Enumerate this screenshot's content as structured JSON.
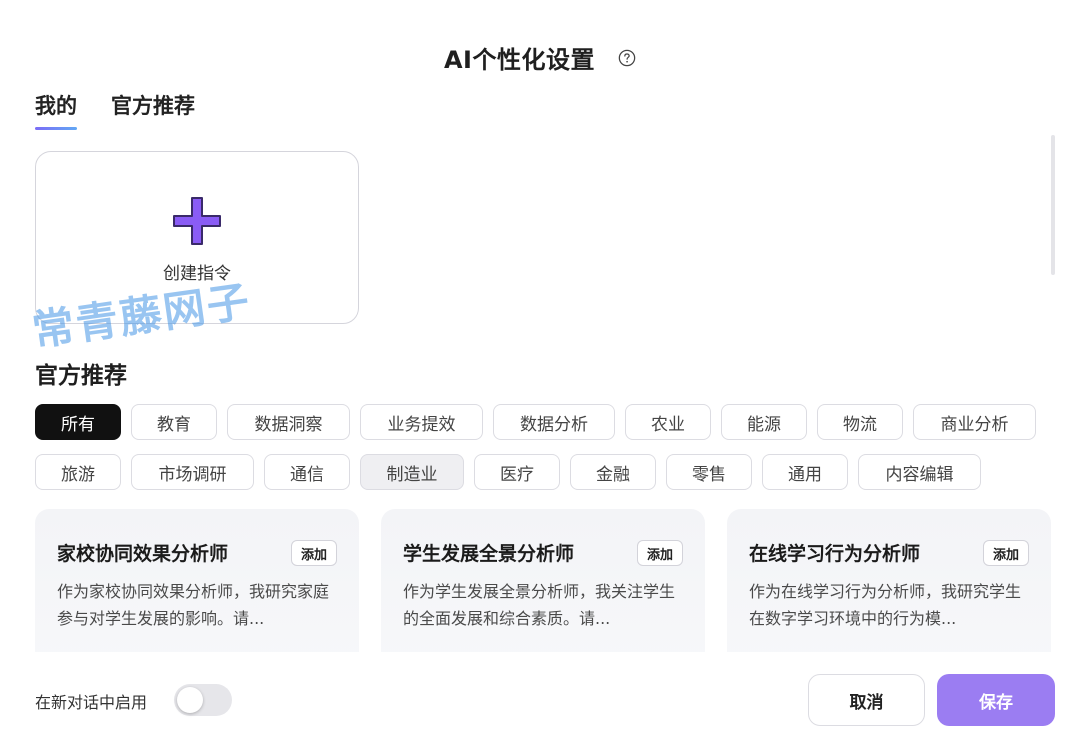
{
  "dialog": {
    "title": "AI个性化设置",
    "help_icon": "question-circle-icon"
  },
  "tabs": [
    {
      "label": "我的",
      "active": true
    },
    {
      "label": "官方推荐",
      "active": false
    }
  ],
  "create_card": {
    "label": "创建指令",
    "icon": "plus-icon",
    "icon_color": "#8a5cf5"
  },
  "watermark": "常青藤网子",
  "section": {
    "title": "官方推荐"
  },
  "filters": {
    "row1": [
      "所有",
      "教育",
      "数据洞察",
      "业务提效",
      "数据分析",
      "农业",
      "能源",
      "物流",
      "商业分析"
    ],
    "row2": [
      "旅游",
      "市场调研",
      "通信",
      "制造业",
      "医疗",
      "金融",
      "零售",
      "通用",
      "内容编辑"
    ],
    "active": "所有",
    "hovered": "制造业"
  },
  "cards": [
    {
      "title": "家校协同效果分析师",
      "add_label": "添加",
      "desc": "作为家校协同效果分析师，我研究家庭参与对学生发展的影响。请..."
    },
    {
      "title": "学生发展全景分析师",
      "add_label": "添加",
      "desc": "作为学生发展全景分析师，我关注学生的全面发展和综合素质。请..."
    },
    {
      "title": "在线学习行为分析师",
      "add_label": "添加",
      "desc": "作为在线学习行为分析师，我研究学生在数字学习环境中的行为模..."
    }
  ],
  "footer": {
    "toggle_label": "在新对话中启用",
    "toggle_on": false,
    "cancel_label": "取消",
    "save_label": "保存",
    "accent_color": "#9b7df2"
  }
}
